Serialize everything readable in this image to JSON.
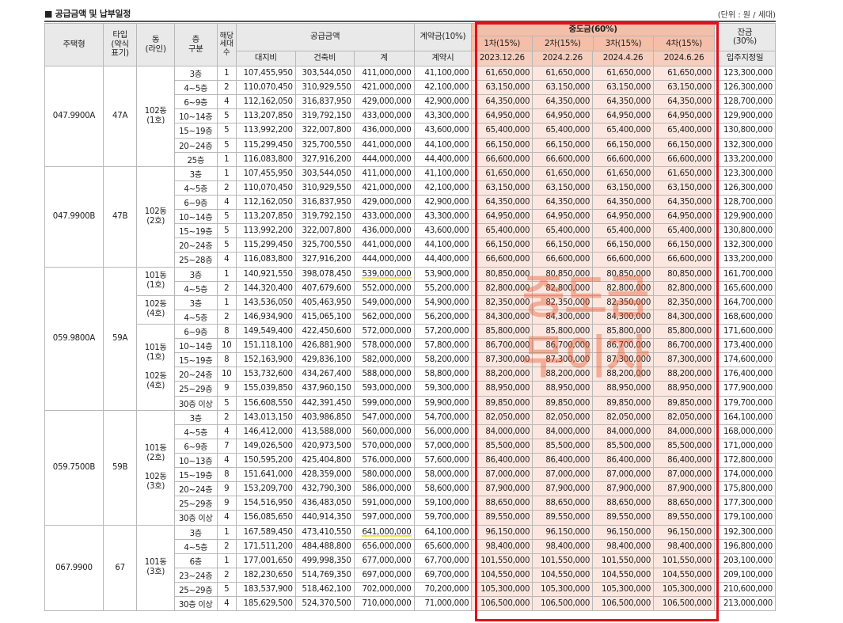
{
  "title": "■ 공급금액 및 납부일정",
  "unit": "(단위 : 원 / 세대)",
  "watermark": [
    "중도금",
    "무이자"
  ],
  "headers": {
    "type": "주택형",
    "typecode": "타입\n(약식\n표기)",
    "dong": "동\n(라인)",
    "floor": "층\n구분",
    "units": "해당\n세대\n수",
    "supply": "공급금액",
    "land": "대지비",
    "building": "건축비",
    "total": "계",
    "contract": "계약금(10%)",
    "contract_sub": "계약시",
    "middle": "중도금(60%)",
    "installments": [
      {
        "label": "1차(15%)",
        "date": "2023.12.26"
      },
      {
        "label": "2차(15%)",
        "date": "2024.2.26"
      },
      {
        "label": "3차(15%)",
        "date": "2024.4.26"
      },
      {
        "label": "4차(15%)",
        "date": "2024.6.26"
      }
    ],
    "balance": "잔금\n(30%)",
    "balance_sub": "입주지정일"
  },
  "groups": [
    {
      "type": "047.9900A",
      "code": "47A",
      "dongs": [
        {
          "label": "102동\n(1호)",
          "span": 7
        }
      ],
      "rows": [
        [
          "3층",
          "1",
          "107,455,950",
          "303,544,050",
          "411,000,000",
          "41,100,000",
          "61,650,000",
          "61,650,000",
          "61,650,000",
          "61,650,000",
          "123,300,000"
        ],
        [
          "4~5층",
          "2",
          "110,070,450",
          "310,929,550",
          "421,000,000",
          "42,100,000",
          "63,150,000",
          "63,150,000",
          "63,150,000",
          "63,150,000",
          "126,300,000"
        ],
        [
          "6~9층",
          "4",
          "112,162,050",
          "316,837,950",
          "429,000,000",
          "42,900,000",
          "64,350,000",
          "64,350,000",
          "64,350,000",
          "64,350,000",
          "128,700,000"
        ],
        [
          "10~14층",
          "5",
          "113,207,850",
          "319,792,150",
          "433,000,000",
          "43,300,000",
          "64,950,000",
          "64,950,000",
          "64,950,000",
          "64,950,000",
          "129,900,000"
        ],
        [
          "15~19층",
          "5",
          "113,992,200",
          "322,007,800",
          "436,000,000",
          "43,600,000",
          "65,400,000",
          "65,400,000",
          "65,400,000",
          "65,400,000",
          "130,800,000"
        ],
        [
          "20~24층",
          "5",
          "115,299,450",
          "325,700,550",
          "441,000,000",
          "44,100,000",
          "66,150,000",
          "66,150,000",
          "66,150,000",
          "66,150,000",
          "132,300,000"
        ],
        [
          "25층",
          "1",
          "116,083,800",
          "327,916,200",
          "444,000,000",
          "44,400,000",
          "66,600,000",
          "66,600,000",
          "66,600,000",
          "66,600,000",
          "133,200,000"
        ]
      ]
    },
    {
      "type": "047.9900B",
      "code": "47B",
      "dongs": [
        {
          "label": "102동\n(2호)",
          "span": 7
        }
      ],
      "rows": [
        [
          "3층",
          "1",
          "107,455,950",
          "303,544,050",
          "411,000,000",
          "41,100,000",
          "61,650,000",
          "61,650,000",
          "61,650,000",
          "61,650,000",
          "123,300,000"
        ],
        [
          "4~5층",
          "2",
          "110,070,450",
          "310,929,550",
          "421,000,000",
          "42,100,000",
          "63,150,000",
          "63,150,000",
          "63,150,000",
          "63,150,000",
          "126,300,000"
        ],
        [
          "6~9층",
          "4",
          "112,162,050",
          "316,837,950",
          "429,000,000",
          "42,900,000",
          "64,350,000",
          "64,350,000",
          "64,350,000",
          "64,350,000",
          "128,700,000"
        ],
        [
          "10~14층",
          "5",
          "113,207,850",
          "319,792,150",
          "433,000,000",
          "43,300,000",
          "64,950,000",
          "64,950,000",
          "64,950,000",
          "64,950,000",
          "129,900,000"
        ],
        [
          "15~19층",
          "5",
          "113,992,200",
          "322,007,800",
          "436,000,000",
          "43,600,000",
          "65,400,000",
          "65,400,000",
          "65,400,000",
          "65,400,000",
          "130,800,000"
        ],
        [
          "20~24층",
          "5",
          "115,299,450",
          "325,700,550",
          "441,000,000",
          "44,100,000",
          "66,150,000",
          "66,150,000",
          "66,150,000",
          "66,150,000",
          "132,300,000"
        ],
        [
          "25~28층",
          "4",
          "116,083,800",
          "327,916,200",
          "444,000,000",
          "44,400,000",
          "66,600,000",
          "66,600,000",
          "66,600,000",
          "66,600,000",
          "133,200,000"
        ]
      ]
    },
    {
      "type": "059.9800A",
      "code": "59A",
      "dongs": [
        {
          "label": "101동\n(1호)",
          "span": 2
        },
        {
          "label": "102동\n(4호)",
          "span": 2
        },
        {
          "label": "101동\n(1호)\n\n102동\n(4호)",
          "span": 7
        }
      ],
      "rows": [
        [
          "3층",
          "1",
          "140,921,550",
          "398,078,450",
          "539,000,000",
          "53,900,000",
          "80,850,000",
          "80,850,000",
          "80,850,000",
          "80,850,000",
          "161,700,000"
        ],
        [
          "4~5층",
          "2",
          "144,320,400",
          "407,679,600",
          "552,000,000",
          "55,200,000",
          "82,800,000",
          "82,800,000",
          "82,800,000",
          "82,800,000",
          "165,600,000"
        ],
        [
          "3층",
          "1",
          "143,536,050",
          "405,463,950",
          "549,000,000",
          "54,900,000",
          "82,350,000",
          "82,350,000",
          "82,350,000",
          "82,350,000",
          "164,700,000"
        ],
        [
          "4~5층",
          "2",
          "146,934,900",
          "415,065,100",
          "562,000,000",
          "56,200,000",
          "84,300,000",
          "84,300,000",
          "84,300,000",
          "84,300,000",
          "168,600,000"
        ],
        [
          "6~9층",
          "8",
          "149,549,400",
          "422,450,600",
          "572,000,000",
          "57,200,000",
          "85,800,000",
          "85,800,000",
          "85,800,000",
          "85,800,000",
          "171,600,000"
        ],
        [
          "10~14층",
          "10",
          "151,118,100",
          "426,881,900",
          "578,000,000",
          "57,800,000",
          "86,700,000",
          "86,700,000",
          "86,700,000",
          "86,700,000",
          "173,400,000"
        ],
        [
          "15~19층",
          "8",
          "152,163,900",
          "429,836,100",
          "582,000,000",
          "58,200,000",
          "87,300,000",
          "87,300,000",
          "87,300,000",
          "87,300,000",
          "174,600,000"
        ],
        [
          "20~24층",
          "10",
          "153,732,600",
          "434,267,400",
          "588,000,000",
          "58,800,000",
          "88,200,000",
          "88,200,000",
          "88,200,000",
          "88,200,000",
          "176,400,000"
        ],
        [
          "25~29층",
          "9",
          "155,039,850",
          "437,960,150",
          "593,000,000",
          "59,300,000",
          "88,950,000",
          "88,950,000",
          "88,950,000",
          "88,950,000",
          "177,900,000"
        ],
        [
          "30층 이상",
          "5",
          "156,608,550",
          "442,391,450",
          "599,000,000",
          "59,900,000",
          "89,850,000",
          "89,850,000",
          "89,850,000",
          "89,850,000",
          "179,700,000"
        ]
      ]
    },
    {
      "type": "059.7500B",
      "code": "59B",
      "dongs": [
        {
          "label": "101동\n(2호)\n\n102동\n(3호)",
          "span": 8
        }
      ],
      "rows": [
        [
          "3층",
          "2",
          "143,013,150",
          "403,986,850",
          "547,000,000",
          "54,700,000",
          "82,050,000",
          "82,050,000",
          "82,050,000",
          "82,050,000",
          "164,100,000"
        ],
        [
          "4~5층",
          "4",
          "146,412,000",
          "413,588,000",
          "560,000,000",
          "56,000,000",
          "84,000,000",
          "84,000,000",
          "84,000,000",
          "84,000,000",
          "168,000,000"
        ],
        [
          "6~9층",
          "7",
          "149,026,500",
          "420,973,500",
          "570,000,000",
          "57,000,000",
          "85,500,000",
          "85,500,000",
          "85,500,000",
          "85,500,000",
          "171,000,000"
        ],
        [
          "10~13층",
          "4",
          "150,595,200",
          "425,404,800",
          "576,000,000",
          "57,600,000",
          "86,400,000",
          "86,400,000",
          "86,400,000",
          "86,400,000",
          "172,800,000"
        ],
        [
          "15~19층",
          "8",
          "151,641,000",
          "428,359,000",
          "580,000,000",
          "58,000,000",
          "87,000,000",
          "87,000,000",
          "87,000,000",
          "87,000,000",
          "174,000,000"
        ],
        [
          "20~24층",
          "9",
          "153,209,700",
          "432,790,300",
          "586,000,000",
          "58,600,000",
          "87,900,000",
          "87,900,000",
          "87,900,000",
          "87,900,000",
          "175,800,000"
        ],
        [
          "25~29층",
          "9",
          "154,516,950",
          "436,483,050",
          "591,000,000",
          "59,100,000",
          "88,650,000",
          "88,650,000",
          "88,650,000",
          "88,650,000",
          "177,300,000"
        ],
        [
          "30층 이상",
          "4",
          "156,085,650",
          "440,914,350",
          "597,000,000",
          "59,700,000",
          "89,550,000",
          "89,550,000",
          "89,550,000",
          "89,550,000",
          "179,100,000"
        ]
      ]
    },
    {
      "type": "067.9900",
      "code": "67",
      "dongs": [
        {
          "label": "101동\n(3호)",
          "span": 6
        }
      ],
      "rows": [
        [
          "3층",
          "1",
          "167,589,450",
          "473,410,550",
          "641,000,000",
          "64,100,000",
          "96,150,000",
          "96,150,000",
          "96,150,000",
          "96,150,000",
          "192,300,000"
        ],
        [
          "4~5층",
          "2",
          "171,511,200",
          "484,488,800",
          "656,000,000",
          "65,600,000",
          "98,400,000",
          "98,400,000",
          "98,400,000",
          "98,400,000",
          "196,800,000"
        ],
        [
          "6층",
          "1",
          "177,001,650",
          "499,998,350",
          "677,000,000",
          "67,700,000",
          "101,550,000",
          "101,550,000",
          "101,550,000",
          "101,550,000",
          "203,100,000"
        ],
        [
          "23~24층",
          "2",
          "182,230,650",
          "514,769,350",
          "697,000,000",
          "69,700,000",
          "104,550,000",
          "104,550,000",
          "104,550,000",
          "104,550,000",
          "209,100,000"
        ],
        [
          "25~29층",
          "5",
          "183,537,900",
          "518,462,100",
          "702,000,000",
          "70,200,000",
          "105,300,000",
          "105,300,000",
          "105,300,000",
          "105,300,000",
          "210,600,000"
        ],
        [
          "30층 이상",
          "4",
          "185,629,500",
          "524,370,500",
          "710,000,000",
          "71,000,000",
          "106,500,000",
          "106,500,000",
          "106,500,000",
          "106,500,000",
          "213,000,000"
        ]
      ]
    }
  ],
  "highlighted_totals": [
    "539,000,000",
    "641,000,000"
  ]
}
